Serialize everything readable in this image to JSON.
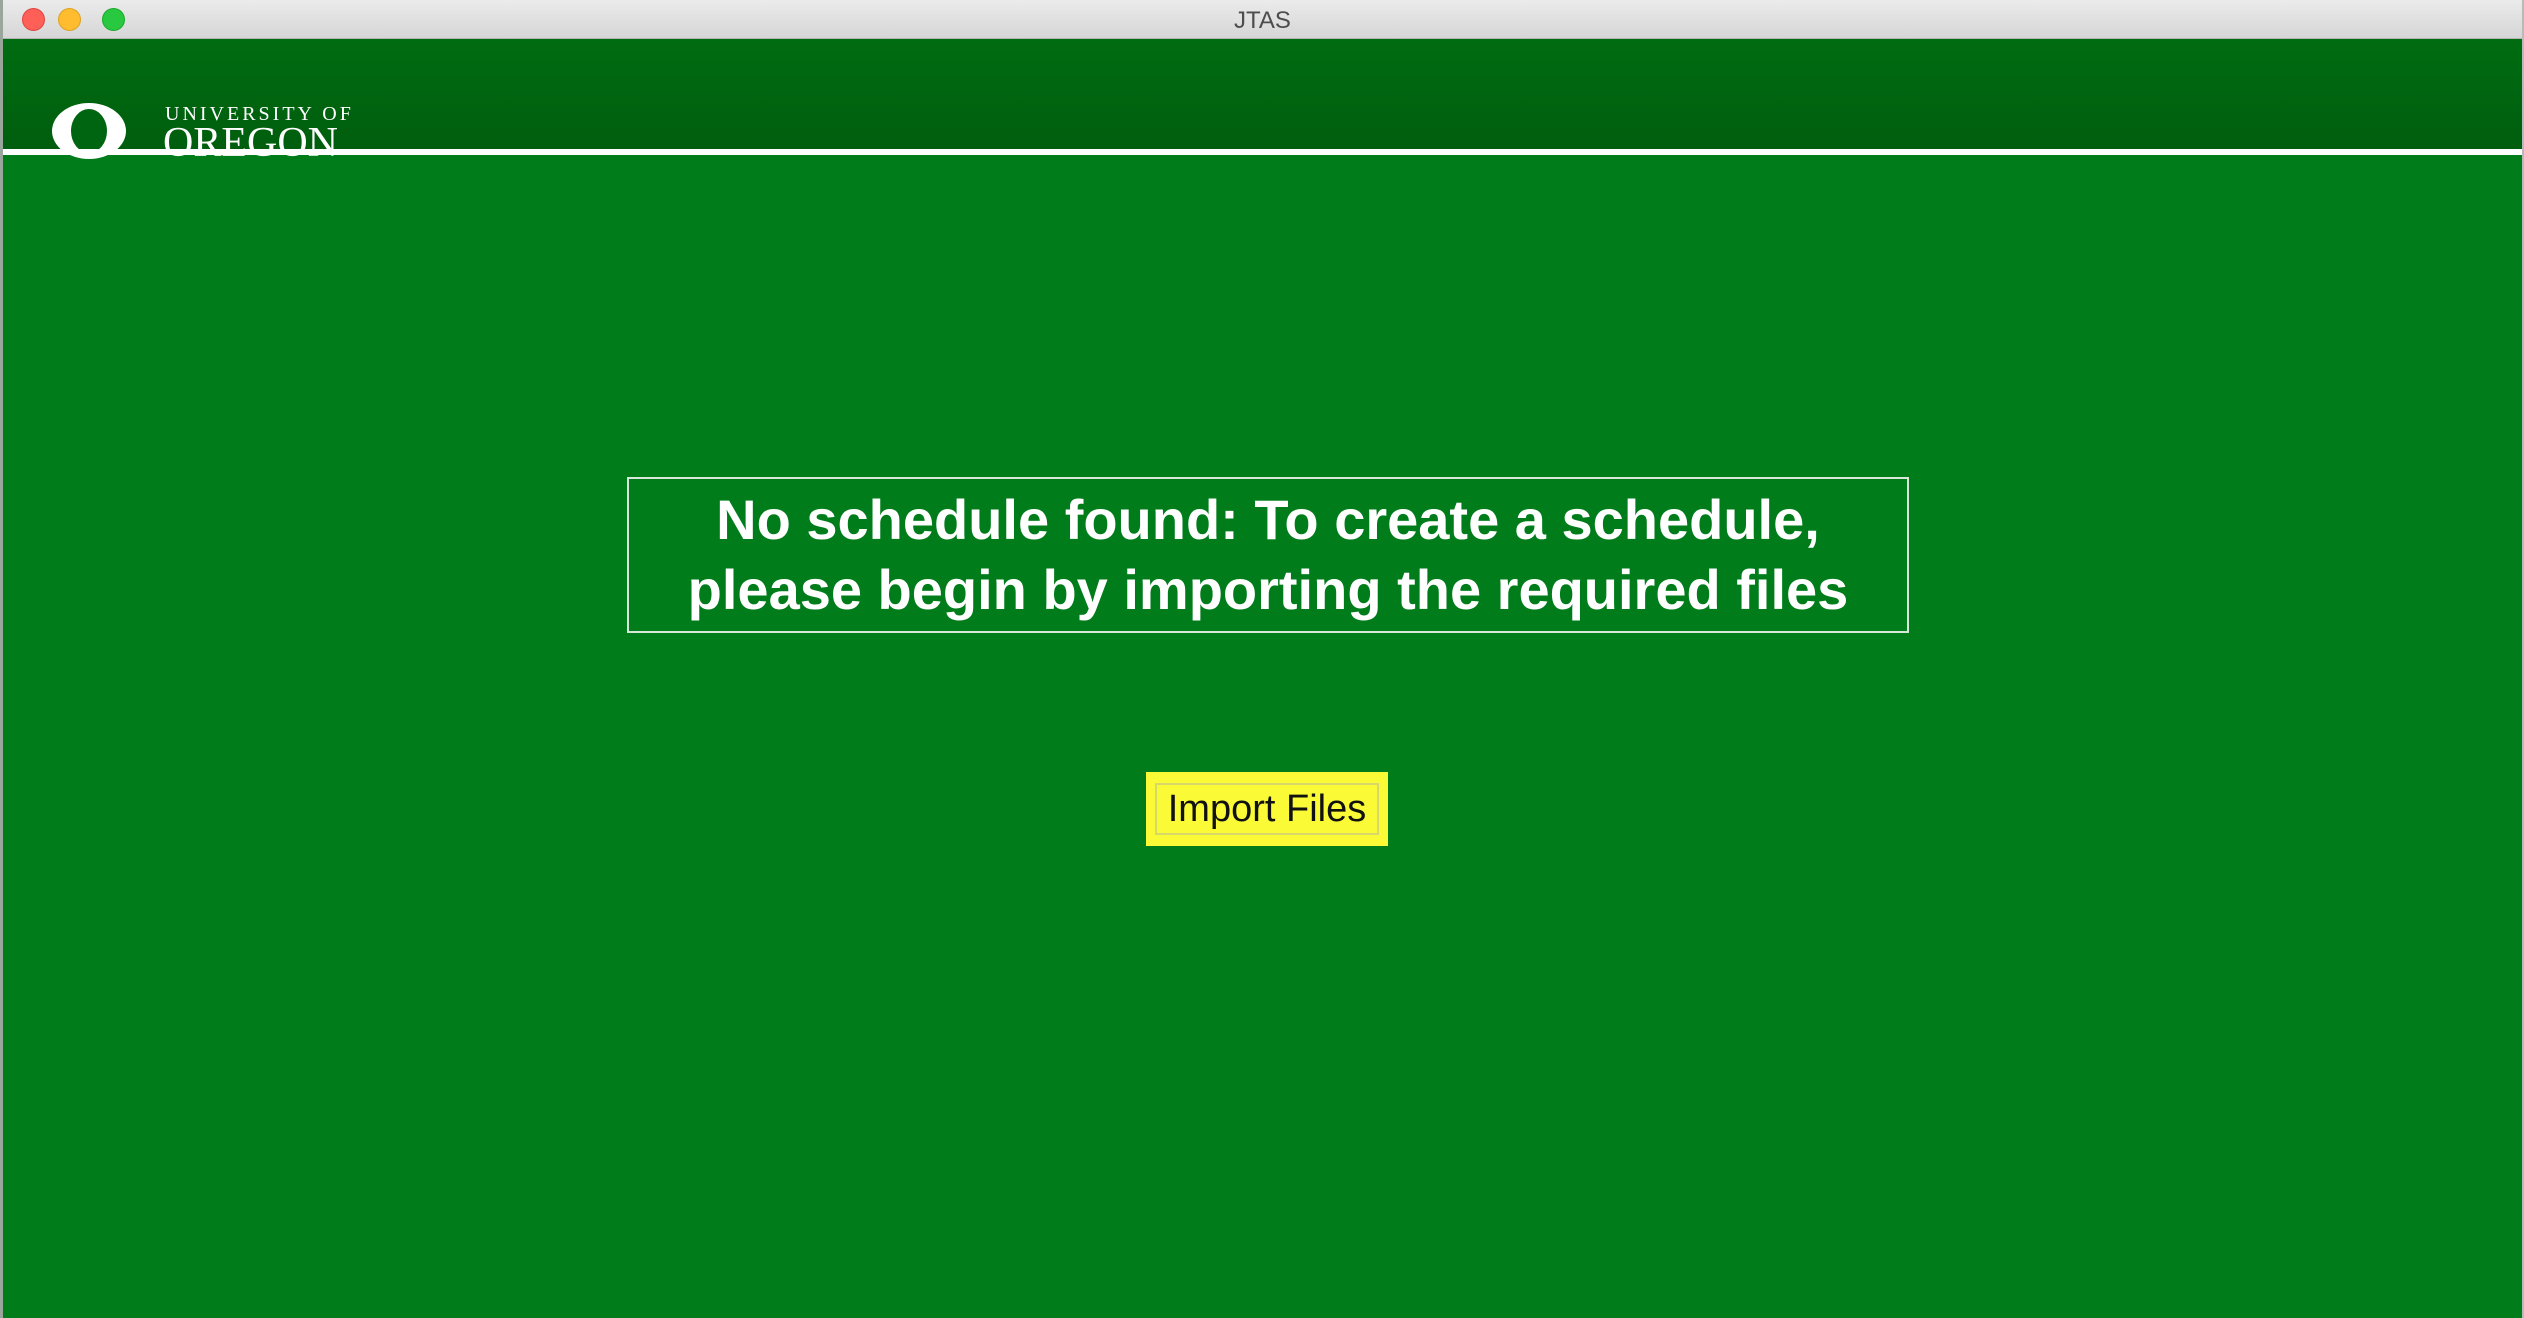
{
  "window": {
    "title": "JTAS"
  },
  "header": {
    "brand_small": "UNIVERSITY OF",
    "brand_large": "OREGON",
    "logo_icon": "uo-o-logo-icon"
  },
  "main": {
    "message": "No schedule found: To create a schedule,\nplease begin by importing the required files",
    "import_button_label": "Import Files"
  },
  "colors": {
    "background": "#007d1a",
    "header": "#006511",
    "button": "#fafa36",
    "text": "#ffffff"
  }
}
